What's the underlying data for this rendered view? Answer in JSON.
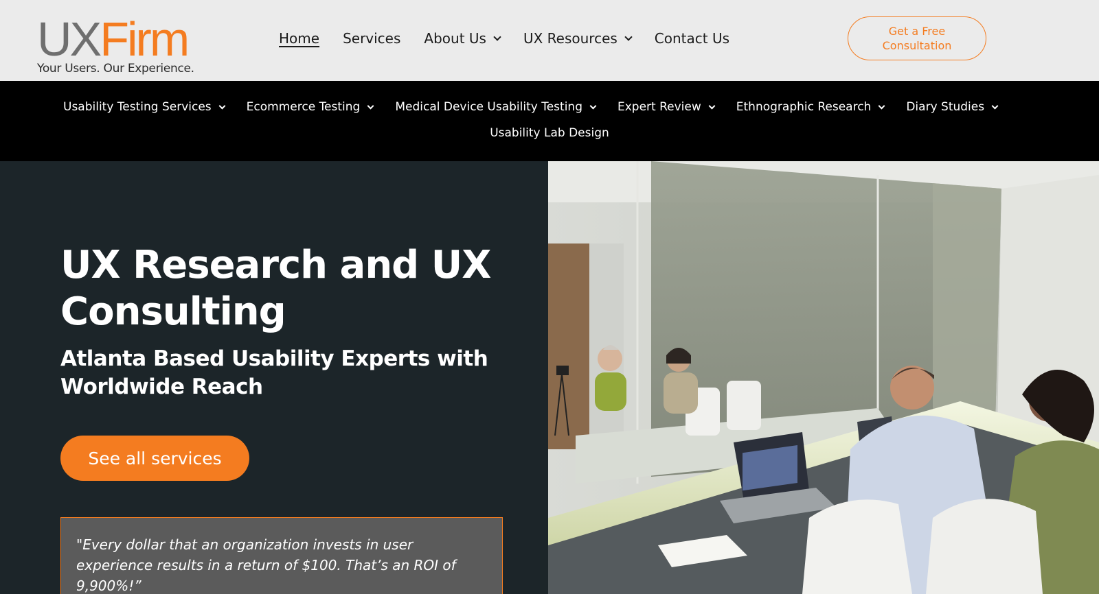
{
  "header": {
    "logo": {
      "ux": "UX",
      "firm": "Firm",
      "tagline": "Your Users. Our Experience."
    },
    "nav": [
      {
        "label": "Home",
        "active": true,
        "dropdown": false
      },
      {
        "label": "Services",
        "active": false,
        "dropdown": false
      },
      {
        "label": "About Us",
        "active": false,
        "dropdown": true
      },
      {
        "label": "UX Resources",
        "active": false,
        "dropdown": true
      },
      {
        "label": "Contact Us",
        "active": false,
        "dropdown": false
      }
    ],
    "cta_label": "Get a Free Consultation"
  },
  "sub_nav": {
    "row1": [
      {
        "label": "Usability Testing Services",
        "dropdown": true
      },
      {
        "label": "Ecommerce Testing",
        "dropdown": true
      },
      {
        "label": "Medical Device Usability Testing",
        "dropdown": true
      },
      {
        "label": "Expert Review",
        "dropdown": true
      },
      {
        "label": "Ethnographic Research",
        "dropdown": true
      },
      {
        "label": "Diary Studies",
        "dropdown": true
      }
    ],
    "row2": [
      {
        "label": "Usability Lab Design",
        "dropdown": false
      }
    ]
  },
  "hero": {
    "title": "UX Research and UX Consulting",
    "subtitle": "Atlanta Based Usability Experts with Worldwide Reach",
    "button_label": "See all services",
    "quote": "\"Every dollar that an organization invests in user experience results in a return of $100. That’s an ROI of 9,900%!”"
  },
  "colors": {
    "accent": "#f47c20",
    "header_bg": "#ebebeb",
    "subnav_bg": "#000000",
    "hero_bg": "#1c2529",
    "quote_bg": "#5b5b5b"
  }
}
